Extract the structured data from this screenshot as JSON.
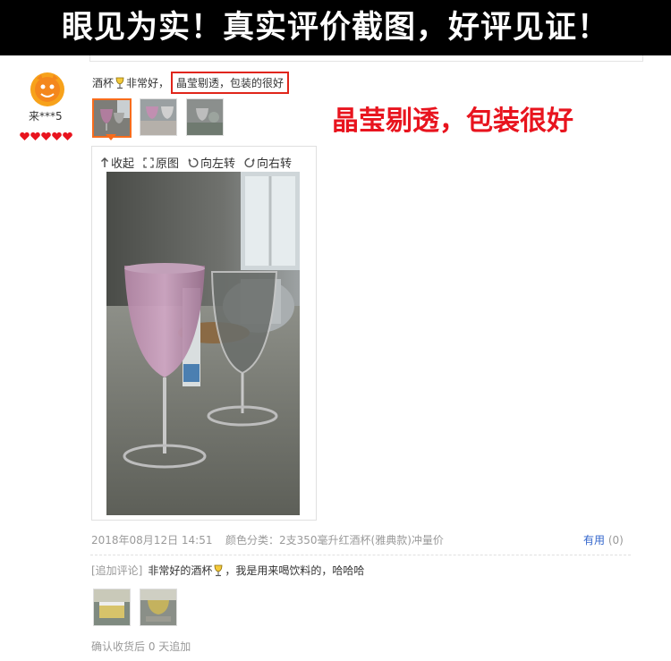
{
  "banner": {
    "title": "眼见为实！真实评价截图，好评见证！"
  },
  "reviewer": {
    "name": "来***5",
    "rank_hearts": 5
  },
  "review": {
    "text_before_icon": "酒杯",
    "text_after_icon": "非常好，",
    "highlight": "晶莹剔透，包装的很好"
  },
  "caption": "晶莹剔透，包装很好",
  "viewer": {
    "tools": [
      "收起",
      "原图",
      "向左转",
      "向右转"
    ]
  },
  "meta": {
    "date": "2018年08月12日 14:51",
    "sku": "颜色分类：2支350毫升红酒杯(雅典款)冲量价",
    "useful_label": "有用",
    "useful_count": "(0)"
  },
  "append": {
    "tag": "[追加评论]",
    "text_before_icon": "非常好的酒杯",
    "text_after_icon": "，我是用来喝饮料的，哈哈哈",
    "after_text": "确认收货后 0 天追加"
  },
  "colors": {
    "highlight_border": "#e0251a",
    "caption_red": "#e8141e",
    "selected_thumb": "#f76c1c",
    "useful_link": "#3366cc"
  }
}
